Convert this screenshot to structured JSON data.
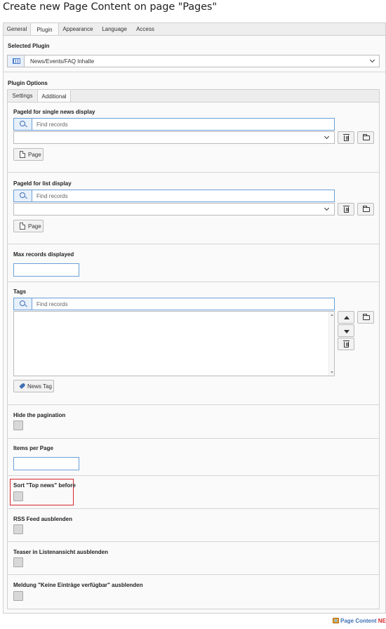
{
  "page": {
    "title": "Create new Page Content on page \"Pages\""
  },
  "main_tabs": [
    {
      "label": "General",
      "active": false
    },
    {
      "label": "Plugin",
      "active": true
    },
    {
      "label": "Appearance",
      "active": false
    },
    {
      "label": "Language",
      "active": false
    },
    {
      "label": "Access",
      "active": false
    }
  ],
  "selected_plugin": {
    "label": "Selected Plugin",
    "value": "News/Events/FAQ Inhalte",
    "icon": "plugin-icon"
  },
  "plugin_options": {
    "label": "Plugin Options"
  },
  "inner_tabs": [
    {
      "label": "Settings",
      "active": false
    },
    {
      "label": "Additional",
      "active": true
    }
  ],
  "fields": {
    "single_news": {
      "label": "PageId for single news display",
      "search_placeholder": "Find records",
      "button_label": "Page"
    },
    "list_display": {
      "label": "PageId for list display",
      "search_placeholder": "Find records",
      "button_label": "Page"
    },
    "max_records": {
      "label": "Max records displayed",
      "value": ""
    },
    "tags": {
      "label": "Tags",
      "search_placeholder": "Find records",
      "button_label": "News Tag"
    },
    "hide_pagination": {
      "label": "Hide the pagination",
      "checked": false
    },
    "items_per_page": {
      "label": "Items per Page",
      "value": ""
    },
    "sort_top_news": {
      "label": "Sort \"Top news\" before",
      "checked": false,
      "highlighted": true
    },
    "rss_feed": {
      "label": "RSS Feed ausblenden",
      "checked": false
    },
    "teaser_list": {
      "label": "Teaser in Listenansicht ausblenden",
      "checked": false
    },
    "no_entries": {
      "label": "Meldung \"Keine Einträge verfügbar\" ausblenden",
      "checked": false
    }
  },
  "footer": {
    "link_text": "Page Content",
    "badge": "NEW"
  },
  "colors": {
    "highlight": "#d9262b",
    "accent": "#3f6fb5",
    "input_border": "#6aa0d8"
  }
}
